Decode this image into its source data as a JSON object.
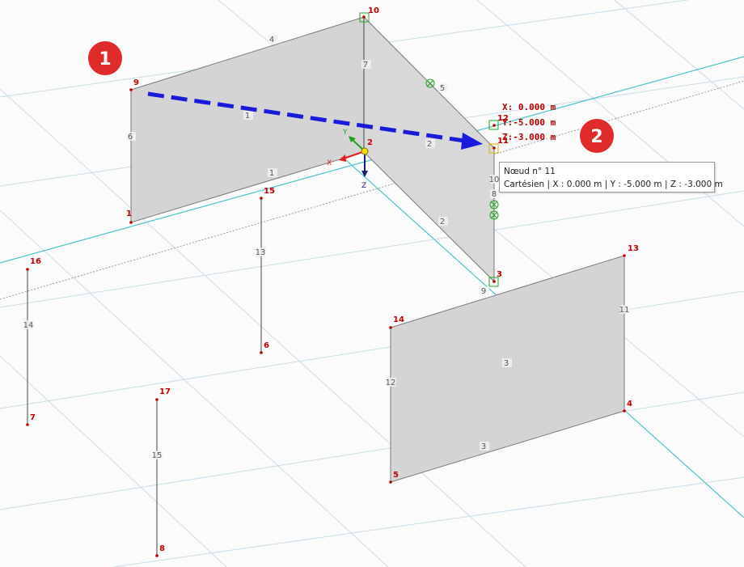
{
  "nodes": [
    {
      "id": "1",
      "label": "1"
    },
    {
      "id": "2",
      "label": "2"
    },
    {
      "id": "3",
      "label": "3"
    },
    {
      "id": "4",
      "label": "4"
    },
    {
      "id": "5",
      "label": "5"
    },
    {
      "id": "6",
      "label": "6"
    },
    {
      "id": "7",
      "label": "7"
    },
    {
      "id": "8",
      "label": "8"
    },
    {
      "id": "9",
      "label": "9"
    },
    {
      "id": "10",
      "label": "10"
    },
    {
      "id": "11",
      "label": "11"
    },
    {
      "id": "12",
      "label": "12"
    },
    {
      "id": "13",
      "label": "13"
    },
    {
      "id": "14",
      "label": "14"
    },
    {
      "id": "15",
      "label": "15"
    },
    {
      "id": "16",
      "label": "16"
    },
    {
      "id": "17",
      "label": "17"
    }
  ],
  "members": [
    {
      "label": "1"
    },
    {
      "label": "1"
    },
    {
      "label": "2"
    },
    {
      "label": "2"
    },
    {
      "label": "3"
    },
    {
      "label": "3"
    },
    {
      "label": "4"
    },
    {
      "label": "5"
    },
    {
      "label": "6"
    },
    {
      "label": "7"
    },
    {
      "label": "8"
    },
    {
      "label": "9"
    },
    {
      "label": "10"
    },
    {
      "label": "11"
    },
    {
      "label": "12"
    },
    {
      "label": "13"
    },
    {
      "label": "14"
    },
    {
      "label": "15"
    }
  ],
  "axes": {
    "x": "X",
    "y": "Y",
    "z": "Z"
  },
  "coords": {
    "x": "X: 0.000 m",
    "y": "Y:-5.000 m",
    "z": "Z:-3.000 m"
  },
  "tooltip": {
    "title": "Nœud n° 11",
    "detail": "Cartésien | X : 0.000 m | Y : -5.000 m | Z : -3.000 m"
  },
  "badges": {
    "first": "1",
    "second": "2"
  },
  "colors": {
    "node": "#c00000",
    "surface": "#d4d4d4",
    "grid": "#c6dbe6",
    "axis_cyan": "#4cc3c8",
    "arrow": "#1a1adb",
    "badge": "#e02b2b",
    "snap": "#28a428"
  }
}
